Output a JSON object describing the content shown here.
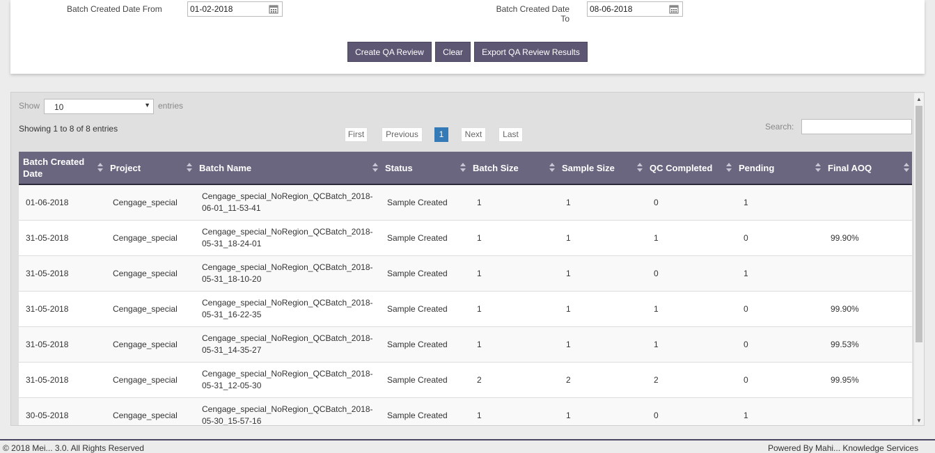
{
  "filters": {
    "from_label": "Batch Created Date From",
    "from_value": "01-02-2018",
    "to_label_line1": "Batch Created Date",
    "to_label_line2": "To",
    "to_value": "08-06-2018"
  },
  "actions": {
    "create_label": "Create QA Review",
    "clear_label": "Clear",
    "export_label": "Export QA Review Results"
  },
  "table_controls": {
    "show_label": "Show",
    "entries_value": "10",
    "entries_label": "entries",
    "info": "Showing 1 to 8 of 8 entries",
    "search_label": "Search:",
    "pagination": {
      "first": "First",
      "previous": "Previous",
      "current": "1",
      "next": "Next",
      "last": "Last"
    }
  },
  "columns": [
    "Batch Created Date",
    "Project",
    "Batch Name",
    "Status",
    "Batch Size",
    "Sample Size",
    "QC Completed",
    "Pending",
    "Final AOQ"
  ],
  "rows": [
    [
      "01-06-2018",
      "Cengage_special",
      "Cengage_special_NoRegion_QCBatch_2018-06-01_11-53-41",
      "Sample Created",
      "1",
      "1",
      "0",
      "1",
      ""
    ],
    [
      "31-05-2018",
      "Cengage_special",
      "Cengage_special_NoRegion_QCBatch_2018-05-31_18-24-01",
      "Sample Created",
      "1",
      "1",
      "1",
      "0",
      "99.90%"
    ],
    [
      "31-05-2018",
      "Cengage_special",
      "Cengage_special_NoRegion_QCBatch_2018-05-31_18-10-20",
      "Sample Created",
      "1",
      "1",
      "0",
      "1",
      ""
    ],
    [
      "31-05-2018",
      "Cengage_special",
      "Cengage_special_NoRegion_QCBatch_2018-05-31_16-22-35",
      "Sample Created",
      "1",
      "1",
      "1",
      "0",
      "99.90%"
    ],
    [
      "31-05-2018",
      "Cengage_special",
      "Cengage_special_NoRegion_QCBatch_2018-05-31_14-35-27",
      "Sample Created",
      "1",
      "1",
      "1",
      "0",
      "99.53%"
    ],
    [
      "31-05-2018",
      "Cengage_special",
      "Cengage_special_NoRegion_QCBatch_2018-05-31_12-05-30",
      "Sample Created",
      "2",
      "2",
      "2",
      "0",
      "99.95%"
    ],
    [
      "30-05-2018",
      "Cengage_special",
      "Cengage_special_NoRegion_QCBatch_2018-05-30_15-57-16",
      "Sample Created",
      "1",
      "1",
      "0",
      "1",
      ""
    ]
  ],
  "footer": {
    "left": "© 2018 Mei... 3.0. All Rights Reserved",
    "right": "Powered By Mahi... Knowledge Services"
  },
  "colors": {
    "header_bg": "#6a6680",
    "button_bg": "#5d5773",
    "page_active": "#337ab7"
  },
  "icons": {
    "date_picker": "calendar-icon",
    "sort": "sort-arrows-icon"
  }
}
